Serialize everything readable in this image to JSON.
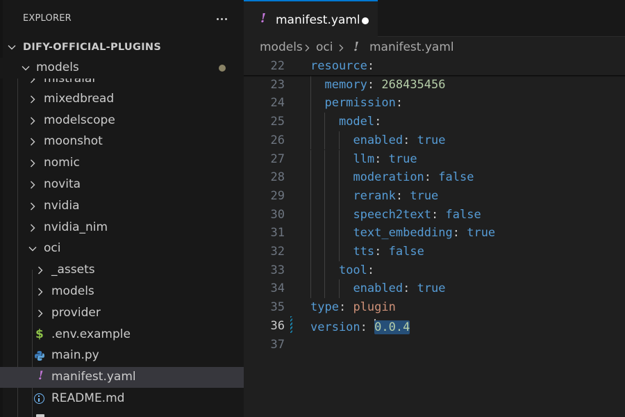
{
  "sidebar": {
    "title": "EXPLORER",
    "workspace": "DIFY-OFFICIAL-PLUGINS",
    "models_folder": "models",
    "partial_folder": "mistralai",
    "folders": [
      "mixedbread",
      "modelscope",
      "moonshot",
      "nomic",
      "novita",
      "nvidia",
      "nvidia_nim"
    ],
    "oci_folder": "oci",
    "oci_subfolders": [
      "_assets",
      "models",
      "provider"
    ],
    "files": {
      "env": ".env.example",
      "main": "main.py",
      "manifest": "manifest.yaml",
      "readme": "README.md"
    }
  },
  "tab": {
    "label": "manifest.yaml"
  },
  "breadcrumb": {
    "part1": "models",
    "part2": "oci",
    "part3": "manifest.yaml"
  },
  "code": {
    "lines": [
      {
        "n": "22",
        "key": "resource",
        "sep": ":",
        "val": "",
        "vtype": "",
        "indent": 0
      },
      {
        "n": "23",
        "key": "memory",
        "sep": ": ",
        "val": "268435456",
        "vtype": "num",
        "indent": 1
      },
      {
        "n": "24",
        "key": "permission",
        "sep": ":",
        "val": "",
        "vtype": "",
        "indent": 1
      },
      {
        "n": "25",
        "key": "model",
        "sep": ":",
        "val": "",
        "vtype": "",
        "indent": 2
      },
      {
        "n": "26",
        "key": "enabled",
        "sep": ": ",
        "val": "true",
        "vtype": "bool",
        "indent": 3
      },
      {
        "n": "27",
        "key": "llm",
        "sep": ": ",
        "val": "true",
        "vtype": "bool",
        "indent": 3
      },
      {
        "n": "28",
        "key": "moderation",
        "sep": ": ",
        "val": "false",
        "vtype": "bool",
        "indent": 3
      },
      {
        "n": "29",
        "key": "rerank",
        "sep": ": ",
        "val": "true",
        "vtype": "bool",
        "indent": 3
      },
      {
        "n": "30",
        "key": "speech2text",
        "sep": ": ",
        "val": "false",
        "vtype": "bool",
        "indent": 3
      },
      {
        "n": "31",
        "key": "text_embedding",
        "sep": ": ",
        "val": "true",
        "vtype": "bool",
        "indent": 3
      },
      {
        "n": "32",
        "key": "tts",
        "sep": ": ",
        "val": "false",
        "vtype": "bool",
        "indent": 3
      },
      {
        "n": "33",
        "key": "tool",
        "sep": ":",
        "val": "",
        "vtype": "",
        "indent": 2
      },
      {
        "n": "34",
        "key": "enabled",
        "sep": ": ",
        "val": "true",
        "vtype": "bool",
        "indent": 3
      },
      {
        "n": "35",
        "key": "type",
        "sep": ": ",
        "val": "plugin",
        "vtype": "str",
        "indent": 0
      },
      {
        "n": "36",
        "key": "version",
        "sep": ": ",
        "val": "0.0.4",
        "vtype": "sel",
        "indent": 0,
        "active": true
      },
      {
        "n": "37",
        "key": "",
        "sep": "",
        "val": "",
        "vtype": "",
        "indent": 0
      }
    ]
  },
  "colors": {
    "accent": "#0078d4",
    "key": "#569cd6",
    "number": "#b5cea8",
    "string": "#ce9178",
    "selection": "#264f78"
  },
  "icons": {
    "more": "ellipsis-icon",
    "chevron_right": "chevron-right-icon",
    "chevron_down": "chevron-down-icon",
    "yaml": "exclamation-icon",
    "env": "dollar-icon",
    "python": "python-icon",
    "readme": "info-icon"
  }
}
